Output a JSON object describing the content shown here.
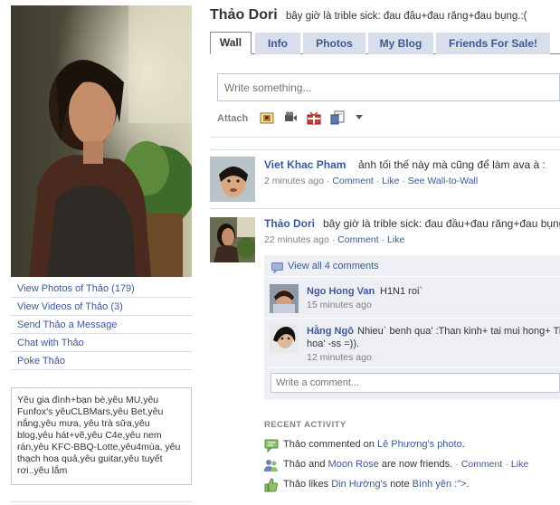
{
  "profile": {
    "name": "Thảo Dori",
    "status": "bây giờ là trible sick: đau đầu+đau răng+đau bụng.:("
  },
  "left_links": [
    "View Photos of Thảo (179)",
    "View Videos of Thảo (3)",
    "Send Thảo a Message",
    "Chat with Thảo",
    "Poke Thảo"
  ],
  "bio": {
    "text": "Yêu gia đình+bạn bè,yêu MU,yêu Funfox's yêuCLBMars,yêu Bet,yêu nắng,yêu mưa, yêu trà sữa,yêu blog,yêu hát+vẽ,yêu C4e,yêu nem rán,yêu KFC-BBQ-Lotte,yêu4mùa, yêu thạch hoa quả,yêu guitar,yêu tuyết rơi..yêu lắm"
  },
  "tabs": [
    "Wall",
    "Info",
    "Photos",
    "My Blog",
    "Friends For Sale!"
  ],
  "composer": {
    "placeholder": "Write something...",
    "attach_label": "Attach",
    "attach_icons": [
      "photo-icon",
      "video-icon",
      "gift-icon",
      "note-icon",
      "dropdown-arrow-icon"
    ]
  },
  "stories": [
    {
      "author": "Viet Khac Pham",
      "text": "ảnh tối thế này mà cũng để làm ava à :",
      "time": "2 minutes ago",
      "sep": "·",
      "links": [
        "Comment",
        "Like",
        "See Wall-to-Wall"
      ]
    },
    {
      "author": "Thảo Dori",
      "text": "bây giờ là trible sick: đau đầu+đau răng+đau bụng",
      "time": "22 minutes ago",
      "sep": "·",
      "links": [
        "Comment",
        "Like"
      ],
      "view_all": "View all 4 comments",
      "comments": [
        {
          "author": "Ngo Hong Van",
          "text": "H1N1 roi`",
          "time": "15 minutes ago"
        },
        {
          "author": "Hằng Ngô",
          "text": "Nhieu` benh qua' :Than kinh+ tai mui hong+ Ti",
          "text2": "hoa' -ss =)).",
          "time": "12 minutes ago"
        }
      ],
      "comment_placeholder": "Write a comment..."
    }
  ],
  "recent_activity": {
    "title": "RECENT ACTIVITY",
    "items": [
      {
        "icon": "comment-icon",
        "pre": "Thảo commented on",
        "link1": "Lê Phương's",
        "link2": "photo",
        "post": "."
      },
      {
        "icon": "friends-icon",
        "pre": "Thảo and",
        "link1": "Moon Rose",
        "post": "are now friends.",
        "sep": "·",
        "links": [
          "Comment",
          "Like"
        ]
      },
      {
        "icon": "like-icon",
        "pre": "Thảo likes",
        "link1": "Din Hường's",
        "mid": "note",
        "link2": "Bình yên :\">",
        "post": "."
      }
    ]
  }
}
